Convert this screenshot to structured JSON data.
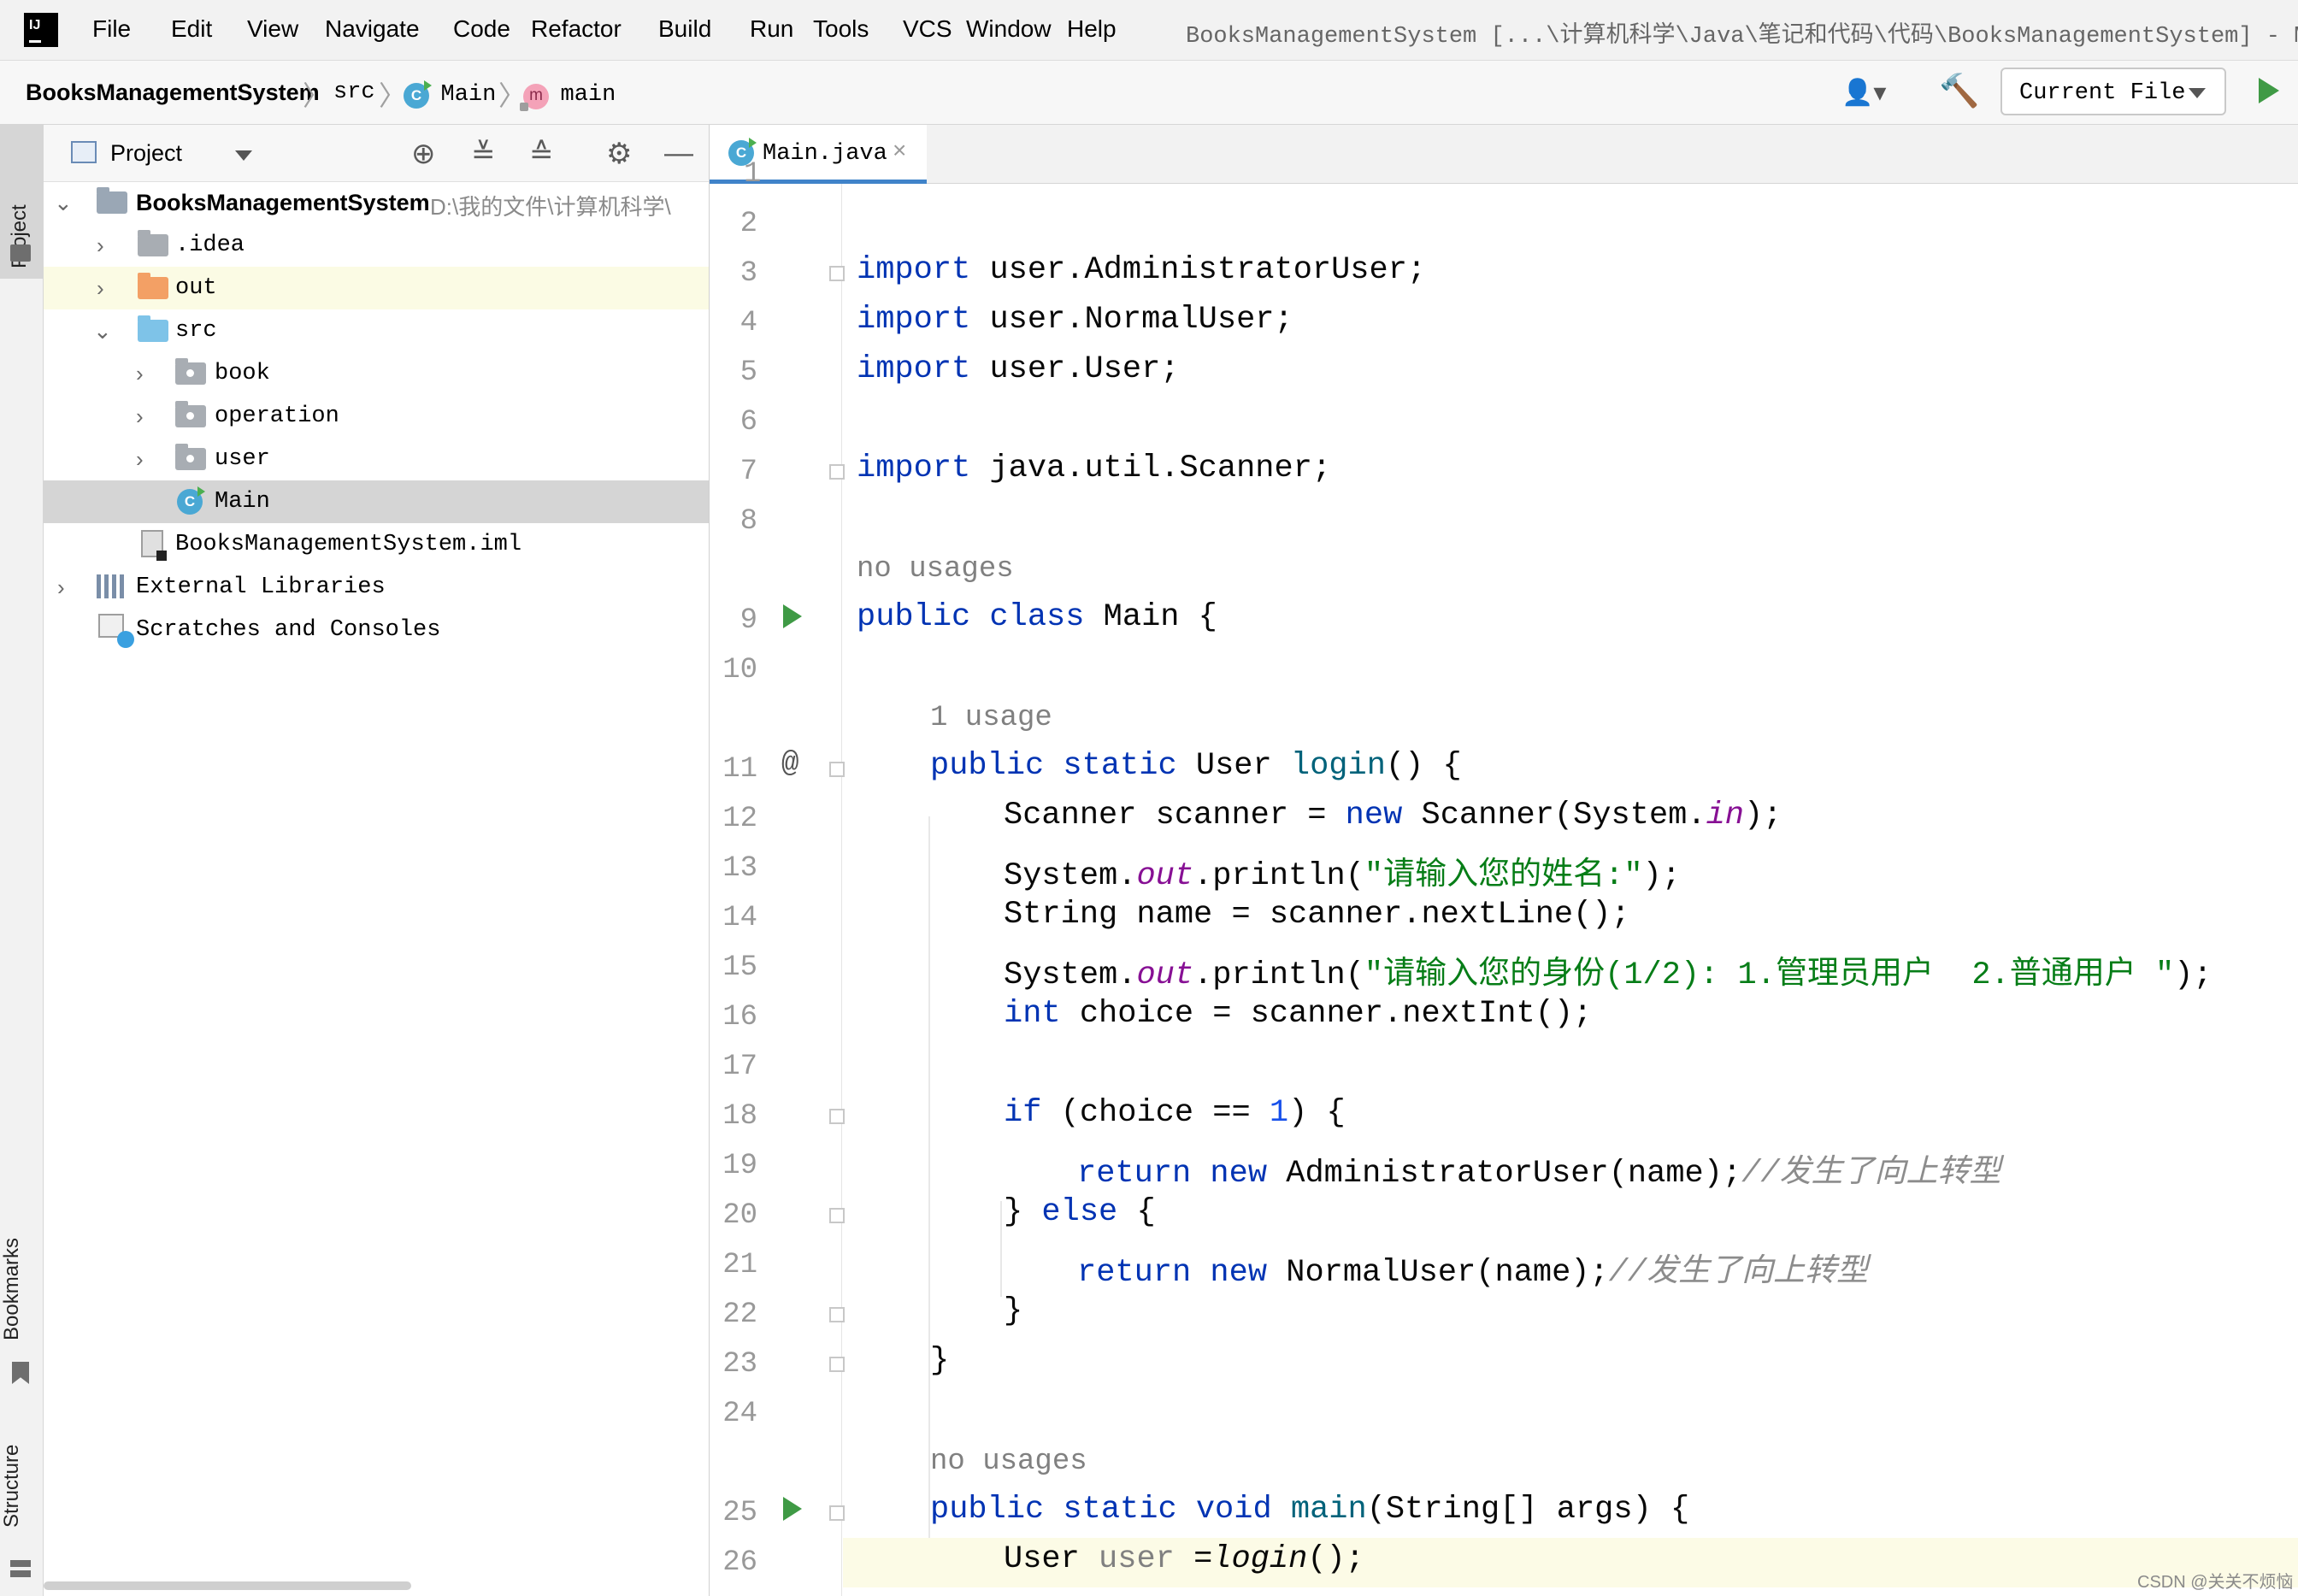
{
  "menu": {
    "items": [
      "File",
      "Edit",
      "View",
      "Navigate",
      "Code",
      "Refactor",
      "Build",
      "Run",
      "Tools",
      "VCS",
      "Window",
      "Help"
    ],
    "window_title": "BooksManagementSystem [...\\计算机科学\\Java\\笔记和代码\\代码\\BooksManagementSystem] - Main.ja"
  },
  "breadcrumb": {
    "project": "BooksManagementSystem",
    "src": "src",
    "class": "Main",
    "method": "main"
  },
  "toolbar": {
    "run_config": "Current File"
  },
  "left_strip": {
    "project_tab": "Project",
    "bookmarks_tab": "Bookmarks",
    "structure_tab": "Structure"
  },
  "project_panel": {
    "title": "Project",
    "root_name": "BooksManagementSystem",
    "root_path": "D:\\我的文件\\计算机科学\\",
    "items": [
      ".idea",
      "out",
      "src",
      "book",
      "operation",
      "user",
      "Main",
      "BooksManagementSystem.iml",
      "External Libraries",
      "Scratches and Consoles"
    ]
  },
  "editor": {
    "tab_title": "Main.java",
    "line_numbers": [
      "2",
      "3",
      "4",
      "5",
      "6",
      "7",
      "8",
      "9",
      "10",
      "11",
      "12",
      "13",
      "14",
      "15",
      "16",
      "17",
      "18",
      "19",
      "20",
      "21",
      "22",
      "23",
      "24",
      "25",
      "26"
    ],
    "hints": [
      "no usages",
      "1 usage",
      "no usages"
    ],
    "code": {
      "l3a": "import",
      "l3b": " user.AdministratorUser;",
      "l4a": "import",
      "l4b": " user.NormalUser;",
      "l5a": "import",
      "l5b": " user.User;",
      "l7a": "import",
      "l7b": " java.util.Scanner;",
      "l9a": "public class",
      "l9b": " Main {",
      "l11a": "public static",
      "l11b": " User ",
      "l11c": "login",
      "l11d": "() {",
      "l12a": "Scanner scanner = ",
      "l12b": "new",
      "l12c": " Scanner(System.",
      "l12d": "in",
      "l12e": ");",
      "l13a": "System.",
      "l13b": "out",
      "l13c": ".println(",
      "l13d": "\"请输入您的姓名:\"",
      "l13e": ");",
      "l14a": "String name = scanner.nextLine();",
      "l15a": "System.",
      "l15b": "out",
      "l15c": ".println(",
      "l15d": "\"请输入您的身份(1/2): 1.管理员用户  2.普通用户 \"",
      "l15e": ");",
      "l16a": "int",
      "l16b": " choice = scanner.nextInt();",
      "l18a": "if",
      "l18b": " (choice == ",
      "l18c": "1",
      "l18d": ") {",
      "l19a": "return new",
      "l19b": " AdministratorUser(name);",
      "l19c": "//发生了向上转型",
      "l20a": "} ",
      "l20b": "else",
      "l20c": " {",
      "l21a": "return new",
      "l21b": " NormalUser(name);",
      "l21c": "//发生了向上转型",
      "l22a": "}",
      "l23a": "}",
      "l25a": "public static void",
      "l25b": " ",
      "l25c": "main",
      "l25d": "(String[] args) {",
      "l26a": "User ",
      "l26b": "user",
      "l26c": " =",
      "l26d": "login",
      "l26e": "();"
    }
  },
  "watermark": "CSDN @关关不烦恼",
  "colors": {
    "keyword": "#0033b3",
    "string": "#067d17",
    "static_field": "#871094",
    "comment": "#8c8c8c",
    "run": "#3f9a45",
    "tab_underline": "#4083c9"
  }
}
